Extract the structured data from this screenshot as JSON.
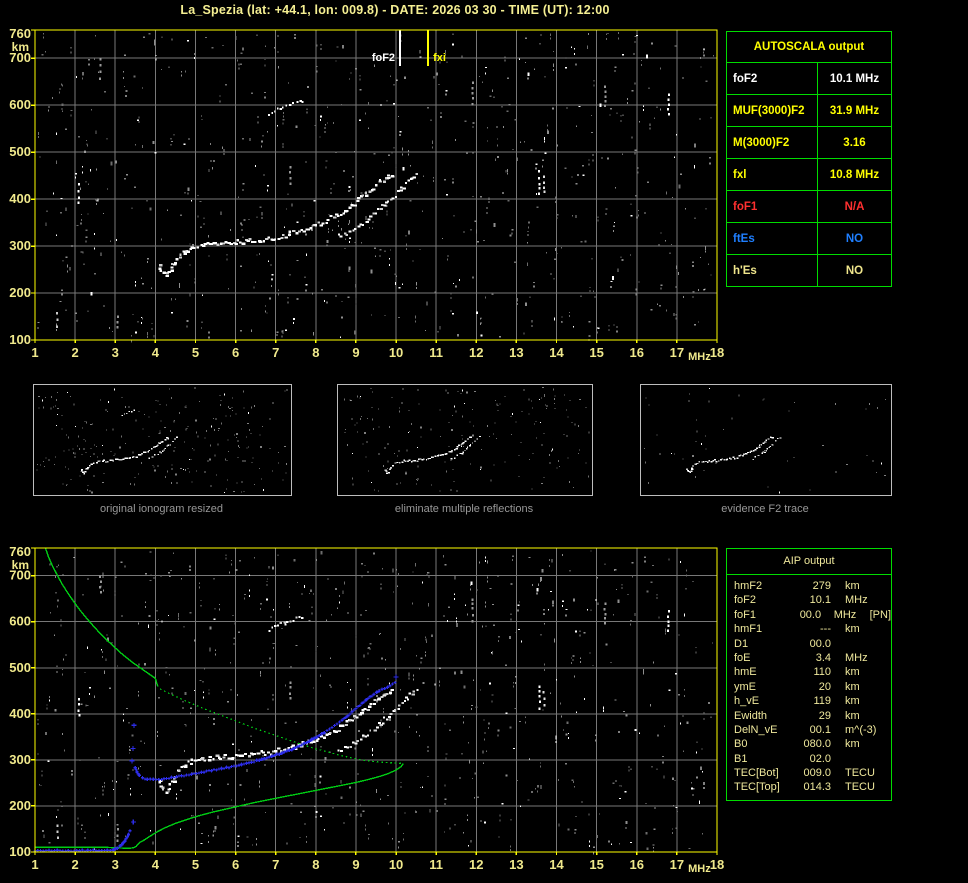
{
  "title": "La_Spezia (lat: +44.1, lon: 009.8) - DATE: 2026 03 30 - TIME (UT): 12:00",
  "autoscala_table": {
    "header": "AUTOSCALA output",
    "rows": [
      {
        "label": "foF2",
        "value": "10.1 MHz",
        "color": "#ffffff"
      },
      {
        "label": "MUF(3000)F2",
        "value": "31.9 MHz",
        "color": "#ffff00"
      },
      {
        "label": "M(3000)F2",
        "value": "3.16",
        "color": "#ffff00"
      },
      {
        "label": "fxl",
        "value": "10.8 MHz",
        "color": "#ffff00"
      },
      {
        "label": "foF1",
        "value": "N/A",
        "color": "#ff3030"
      },
      {
        "label": "ftEs",
        "value": "NO",
        "color": "#1f7fff"
      },
      {
        "label": "h'Es",
        "value": "NO",
        "color": "#f0e68c"
      }
    ]
  },
  "aip_table": {
    "header": "AIP output",
    "rows": [
      {
        "label": "hmF2",
        "value": "279",
        "unit": "km",
        "extra": ""
      },
      {
        "label": "foF2",
        "value": "10.1",
        "unit": "MHz",
        "extra": ""
      },
      {
        "label": "foF1",
        "value": "00.0",
        "unit": "MHz",
        "extra": "[PN]"
      },
      {
        "label": "hmF1",
        "value": "---",
        "unit": "km",
        "extra": ""
      },
      {
        "label": "D1",
        "value": "00.0",
        "unit": "",
        "extra": ""
      },
      {
        "label": "foE",
        "value": "3.4",
        "unit": "MHz",
        "extra": ""
      },
      {
        "label": "hmE",
        "value": "110",
        "unit": "km",
        "extra": ""
      },
      {
        "label": "ymE",
        "value": "20",
        "unit": "km",
        "extra": ""
      },
      {
        "label": "h_vE",
        "value": "119",
        "unit": "km",
        "extra": ""
      },
      {
        "label": "Ewidth",
        "value": "29",
        "unit": "km",
        "extra": ""
      },
      {
        "label": "DelN_vE",
        "value": "00.1",
        "unit": "m^(-3)",
        "extra": ""
      },
      {
        "label": "B0",
        "value": "080.0",
        "unit": "km",
        "extra": ""
      },
      {
        "label": "B1",
        "value": "02.0",
        "unit": "",
        "extra": ""
      },
      {
        "label": "TEC[Bot]",
        "value": "009.0",
        "unit": "TECU",
        "extra": ""
      },
      {
        "label": "TEC[Top]",
        "value": "014.3",
        "unit": "TECU",
        "extra": ""
      }
    ]
  },
  "thumbnails": [
    {
      "caption": "original ionogram resized"
    },
    {
      "caption": "eliminate multiple reflections"
    },
    {
      "caption": "evidence F2 trace"
    }
  ],
  "axes": {
    "x_ticks": [
      1,
      2,
      3,
      4,
      5,
      6,
      7,
      8,
      9,
      10,
      11,
      12,
      13,
      14,
      15,
      16,
      17,
      18
    ],
    "x_unit": "MHz",
    "y_ticks": [
      760,
      700,
      600,
      500,
      400,
      300,
      200,
      100
    ],
    "y_unit": "km"
  },
  "markers": {
    "foF2": {
      "label": "foF2",
      "f": 10.1,
      "color": "#ffffff"
    },
    "fxI": {
      "label": "fxi",
      "f": 10.8,
      "color": "#ffff00"
    }
  },
  "colors": {
    "plot_border": "#ffff00",
    "grid": "#787878",
    "axis_text": "#f0e98c",
    "table_border": "#00dc00",
    "echo_trace": "#ffffff",
    "profile_green": "#00cc14",
    "autoscaled_blue": "#2d2de8",
    "caption_gray": "#989898"
  },
  "noise": {
    "streaks": [
      {
        "f": 2.08,
        "km1": 388,
        "km2": 434,
        "c": "#ffffff"
      },
      {
        "f": 13.56,
        "km1": 406,
        "km2": 462,
        "c": "#ffffff"
      },
      {
        "f": 13.68,
        "km1": 418,
        "km2": 450,
        "c": "#e0e0e0"
      },
      {
        "f": 16.78,
        "km1": 575,
        "km2": 625,
        "c": "#ffffff"
      },
      {
        "f": 2.62,
        "km1": 655,
        "km2": 700,
        "c": "#9a9a9a"
      },
      {
        "f": 11.9,
        "km1": 600,
        "km2": 650,
        "c": "#9a9a9a"
      },
      {
        "f": 15.2,
        "km1": 598,
        "km2": 642,
        "c": "#9a9a9a"
      },
      {
        "f": 7.35,
        "km1": 432,
        "km2": 470,
        "c": "#9a9a9a"
      },
      {
        "f": 1.55,
        "km1": 120,
        "km2": 160,
        "c": "#cccccc"
      },
      {
        "f": 3.05,
        "km1": 118,
        "km2": 152,
        "c": "#9a9a9a"
      }
    ]
  },
  "chart_data": [
    {
      "type": "scatter",
      "title": "ionogram (virtual height vs frequency)",
      "xlabel": "MHz",
      "ylabel": "km",
      "xlim": [
        1,
        18
      ],
      "ylim": [
        100,
        760
      ],
      "grid": true,
      "legend": "none",
      "markers": {
        "foF2_MHz": 10.1,
        "fxI_MHz": 10.8
      },
      "series": [
        {
          "name": "F2 O-mode echo trace",
          "color": "#ffffff",
          "points": [
            [
              4.08,
              258
            ],
            [
              4.12,
              248
            ],
            [
              4.18,
              240
            ],
            [
              4.25,
              236
            ],
            [
              4.32,
              244
            ],
            [
              4.38,
              254
            ],
            [
              4.45,
              264
            ],
            [
              4.52,
              274
            ],
            [
              4.62,
              284
            ],
            [
              4.75,
              293
            ],
            [
              4.9,
              299
            ],
            [
              5.1,
              303
            ],
            [
              5.35,
              306
            ],
            [
              5.6,
              308
            ],
            [
              5.85,
              309
            ],
            [
              6.1,
              311
            ],
            [
              6.35,
              313
            ],
            [
              6.6,
              316
            ],
            [
              6.85,
              319
            ],
            [
              7.1,
              323
            ],
            [
              7.35,
              328
            ],
            [
              7.6,
              334
            ],
            [
              7.85,
              342
            ],
            [
              8.1,
              351
            ],
            [
              8.35,
              361
            ],
            [
              8.6,
              373
            ],
            [
              8.85,
              387
            ],
            [
              9.05,
              400
            ],
            [
              9.25,
              414
            ],
            [
              9.45,
              428
            ],
            [
              9.6,
              440
            ],
            [
              9.75,
              449
            ],
            [
              9.85,
              448
            ],
            [
              9.93,
              455
            ]
          ]
        },
        {
          "name": "F2 X-mode echo trace",
          "color": "#ffffff",
          "points": [
            [
              8.55,
              322
            ],
            [
              8.75,
              330
            ],
            [
              8.95,
              340
            ],
            [
              9.15,
              351
            ],
            [
              9.35,
              364
            ],
            [
              9.55,
              378
            ],
            [
              9.75,
              394
            ],
            [
              9.95,
              410
            ],
            [
              10.12,
              425
            ],
            [
              10.28,
              438
            ],
            [
              10.42,
              449
            ],
            [
              10.55,
              458
            ]
          ]
        },
        {
          "name": "second-hop multiple echo",
          "color": "#ffffff",
          "points": [
            [
              6.8,
              583
            ],
            [
              6.95,
              590
            ],
            [
              7.1,
              596
            ],
            [
              7.25,
              601
            ],
            [
              7.42,
              606
            ],
            [
              7.58,
              610
            ],
            [
              7.72,
              613
            ]
          ]
        }
      ]
    },
    {
      "type": "line",
      "title": "electron density profile and autoscaled trace",
      "xlabel": "MHz",
      "ylabel": "km",
      "xlim": [
        1,
        18
      ],
      "ylim": [
        100,
        760
      ],
      "grid": true,
      "legend": "none",
      "series": [
        {
          "name": "Ne profile topside",
          "color": "#00cc14",
          "style": "solid",
          "points": [
            [
              1.26,
              760
            ],
            [
              1.34,
              740
            ],
            [
              1.44,
              720
            ],
            [
              1.56,
              700
            ],
            [
              1.68,
              681
            ],
            [
              1.82,
              662
            ],
            [
              1.97,
              643
            ],
            [
              2.13,
              624
            ],
            [
              2.31,
              605
            ],
            [
              2.5,
              586
            ],
            [
              2.71,
              567
            ],
            [
              2.94,
              548
            ],
            [
              3.18,
              529
            ],
            [
              3.44,
              511
            ],
            [
              3.72,
              494
            ],
            [
              4.0,
              477
            ],
            [
              4.05,
              462
            ]
          ]
        },
        {
          "name": "Ne profile modeled mid (dotted)",
          "color": "#00cc14",
          "style": "dotted",
          "points": [
            [
              4.05,
              462
            ],
            [
              4.1,
              455
            ],
            [
              4.4,
              442
            ],
            [
              4.7,
              430
            ],
            [
              5.0,
              419
            ],
            [
              5.3,
              408
            ],
            [
              5.6,
              398
            ],
            [
              5.9,
              388
            ],
            [
              6.2,
              378
            ],
            [
              6.5,
              368
            ],
            [
              6.8,
              359
            ],
            [
              7.1,
              350
            ],
            [
              7.4,
              341
            ],
            [
              7.7,
              332
            ],
            [
              8.0,
              324
            ],
            [
              8.3,
              317
            ],
            [
              8.6,
              310
            ],
            [
              8.9,
              304
            ],
            [
              9.2,
              299
            ],
            [
              9.5,
              296
            ],
            [
              9.8,
              294
            ],
            [
              10.05,
              293
            ],
            [
              10.18,
              292
            ]
          ]
        },
        {
          "name": "Ne profile bottomside",
          "color": "#00cc14",
          "style": "solid",
          "points": [
            [
              10.18,
              292
            ],
            [
              10.12,
              285
            ],
            [
              10.0,
              278
            ],
            [
              9.8,
              270
            ],
            [
              9.55,
              263
            ],
            [
              9.25,
              256
            ],
            [
              8.95,
              250
            ],
            [
              8.6,
              244
            ],
            [
              8.25,
              238
            ],
            [
              7.9,
              232
            ],
            [
              7.55,
              226
            ],
            [
              7.2,
              220
            ],
            [
              6.85,
              214
            ],
            [
              6.5,
              208
            ],
            [
              6.15,
              201
            ],
            [
              5.8,
              194
            ],
            [
              5.45,
              187
            ],
            [
              5.1,
              179
            ],
            [
              4.8,
              171
            ],
            [
              4.5,
              162
            ],
            [
              4.25,
              153
            ],
            [
              4.05,
              144
            ],
            [
              3.88,
              135
            ],
            [
              3.74,
              127
            ],
            [
              3.62,
              121
            ],
            [
              3.56,
              116
            ],
            [
              3.52,
              112
            ],
            [
              3.44,
              109
            ],
            [
              3.3,
              108
            ],
            [
              3.1,
              109
            ],
            [
              2.8,
              110
            ],
            [
              2.4,
              110
            ],
            [
              2.0,
              110
            ],
            [
              1.5,
              110
            ],
            [
              1.0,
              110
            ]
          ]
        },
        {
          "name": "autoscaled trace E region",
          "color": "#2d2de8",
          "style": "plus",
          "points": [
            [
              1.0,
              103
            ],
            [
              2.8,
              103
            ],
            [
              2.95,
              105
            ],
            [
              3.05,
              108
            ],
            [
              3.12,
              113
            ],
            [
              3.2,
              120
            ],
            [
              3.27,
              129
            ],
            [
              3.33,
              138
            ],
            [
              3.37,
              146
            ]
          ]
        },
        {
          "name": "autoscaled trace F region",
          "color": "#2d2de8",
          "style": "plus",
          "points": [
            [
              3.5,
              284
            ],
            [
              3.54,
              274
            ],
            [
              3.6,
              266
            ],
            [
              3.68,
              261
            ],
            [
              3.8,
              258
            ],
            [
              3.95,
              257
            ],
            [
              4.15,
              258
            ],
            [
              4.4,
              261
            ],
            [
              4.65,
              265
            ],
            [
              4.9,
              269
            ],
            [
              5.15,
              273
            ],
            [
              5.4,
              277
            ],
            [
              5.65,
              281
            ],
            [
              5.9,
              285
            ],
            [
              6.15,
              290
            ],
            [
              6.4,
              295
            ],
            [
              6.65,
              301
            ],
            [
              6.9,
              308
            ],
            [
              7.15,
              315
            ],
            [
              7.4,
              323
            ],
            [
              7.65,
              333
            ],
            [
              7.9,
              344
            ],
            [
              8.15,
              356
            ],
            [
              8.4,
              370
            ],
            [
              8.65,
              386
            ],
            [
              8.85,
              400
            ],
            [
              9.05,
              415
            ],
            [
              9.25,
              430
            ],
            [
              9.45,
              443
            ],
            [
              9.65,
              453
            ],
            [
              9.85,
              461
            ],
            [
              9.97,
              468
            ]
          ]
        },
        {
          "name": "isolated fitted points",
          "color": "#2d2de8",
          "style": "plus-isolated",
          "points": [
            [
              3.45,
              165
            ],
            [
              3.42,
              298
            ],
            [
              3.44,
              325
            ],
            [
              3.47,
              375
            ],
            [
              10.0,
              480
            ]
          ]
        }
      ]
    }
  ]
}
